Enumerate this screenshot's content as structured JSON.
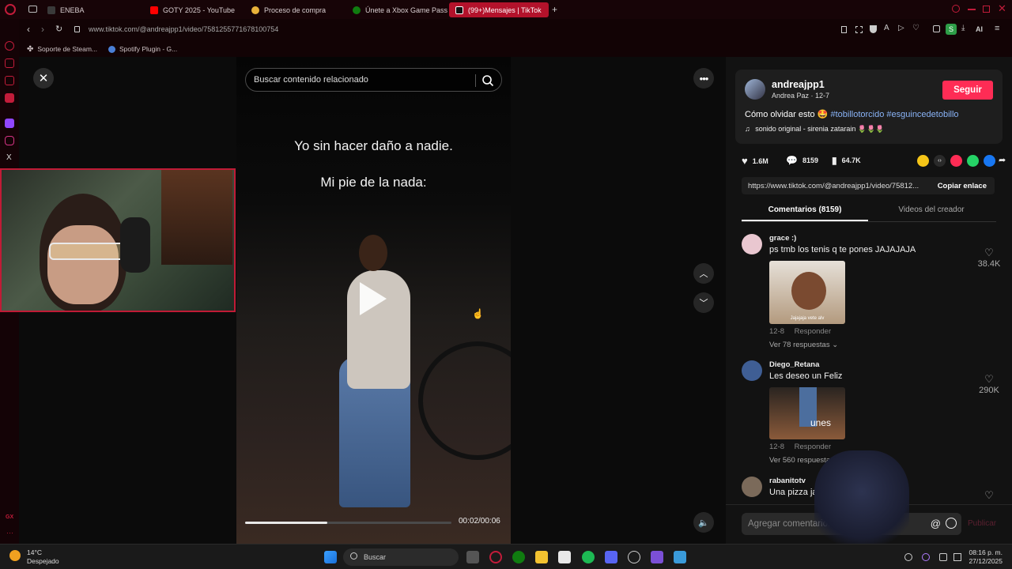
{
  "browser": {
    "tabs": [
      {
        "label": "ENEBA",
        "color": "#2f2f2f"
      },
      {
        "label": "GOTY 2025 - YouTube",
        "color": "#ff0000"
      },
      {
        "label": "Proceso de compra",
        "color": "#e8b23a"
      },
      {
        "label": "Únete a Xbox Game Pass",
        "color": "#107c10"
      },
      {
        "label": "(99+)Mensajes | TikTok",
        "color": "#111111",
        "active": true
      }
    ],
    "url": "www.tiktok.com/@andreajpp1/video/7581255771678100754",
    "bookmarks": [
      "Soporte de Steam...",
      "Spotify Plugin - G..."
    ],
    "ai_label": "AI"
  },
  "video": {
    "search_placeholder": "Buscar contenido relacionado",
    "caption_line1": "Yo sin hacer daño a nadie.",
    "caption_line2": "Mi pie de la nada:",
    "time": "00:02/00:06",
    "progress": 0.4
  },
  "creator": {
    "username": "andreajpp1",
    "display": "Andrea Paz · 12-7",
    "follow": "Seguir",
    "description": "Cómo olvidar esto 🤩",
    "hashtags": "#tobillotorcido #esguincedetobillo",
    "sound": "sonido original - sirenia zatarain 🌷🌷🌷"
  },
  "stats": {
    "likes": "1.6M",
    "comments": "8159",
    "saves": "64.7K"
  },
  "share": {
    "link": "https://www.tiktok.com/@andreajpp1/video/75812...",
    "copy": "Copiar enlace"
  },
  "tabs": {
    "comments": "Comentarios (8159)",
    "creator_videos": "Videos del creador"
  },
  "comments": [
    {
      "user": "grace :)",
      "text": "ps tmb los tenis q te pones JAJAJAJA",
      "image_caption": "Jajajaja vete alv",
      "date": "12-8",
      "reply": "Responder",
      "more": "Ver 78 respuestas ⌄",
      "likes": "38.4K"
    },
    {
      "user": "Diego_Retana",
      "text": "Les deseo un Feliz",
      "image_caption": "unes",
      "date": "12-8",
      "reply": "Responder",
      "more": "Ver 560 respuestas",
      "likes": "290K"
    },
    {
      "user": "rabanitotv",
      "text": "Una pizza jamás"
    }
  ],
  "comment_bar": {
    "placeholder": "Agregar comentario...",
    "at": "@",
    "publish": "Publicar"
  },
  "taskbar": {
    "temp": "14°C",
    "weather": "Despejado",
    "search": "Buscar",
    "time": "08:16 p. m.",
    "date": "27/12/2025"
  },
  "colors": {
    "accent": "#fe2c55",
    "opera_red": "#c21c3a",
    "tab_active": "#b3122b"
  }
}
